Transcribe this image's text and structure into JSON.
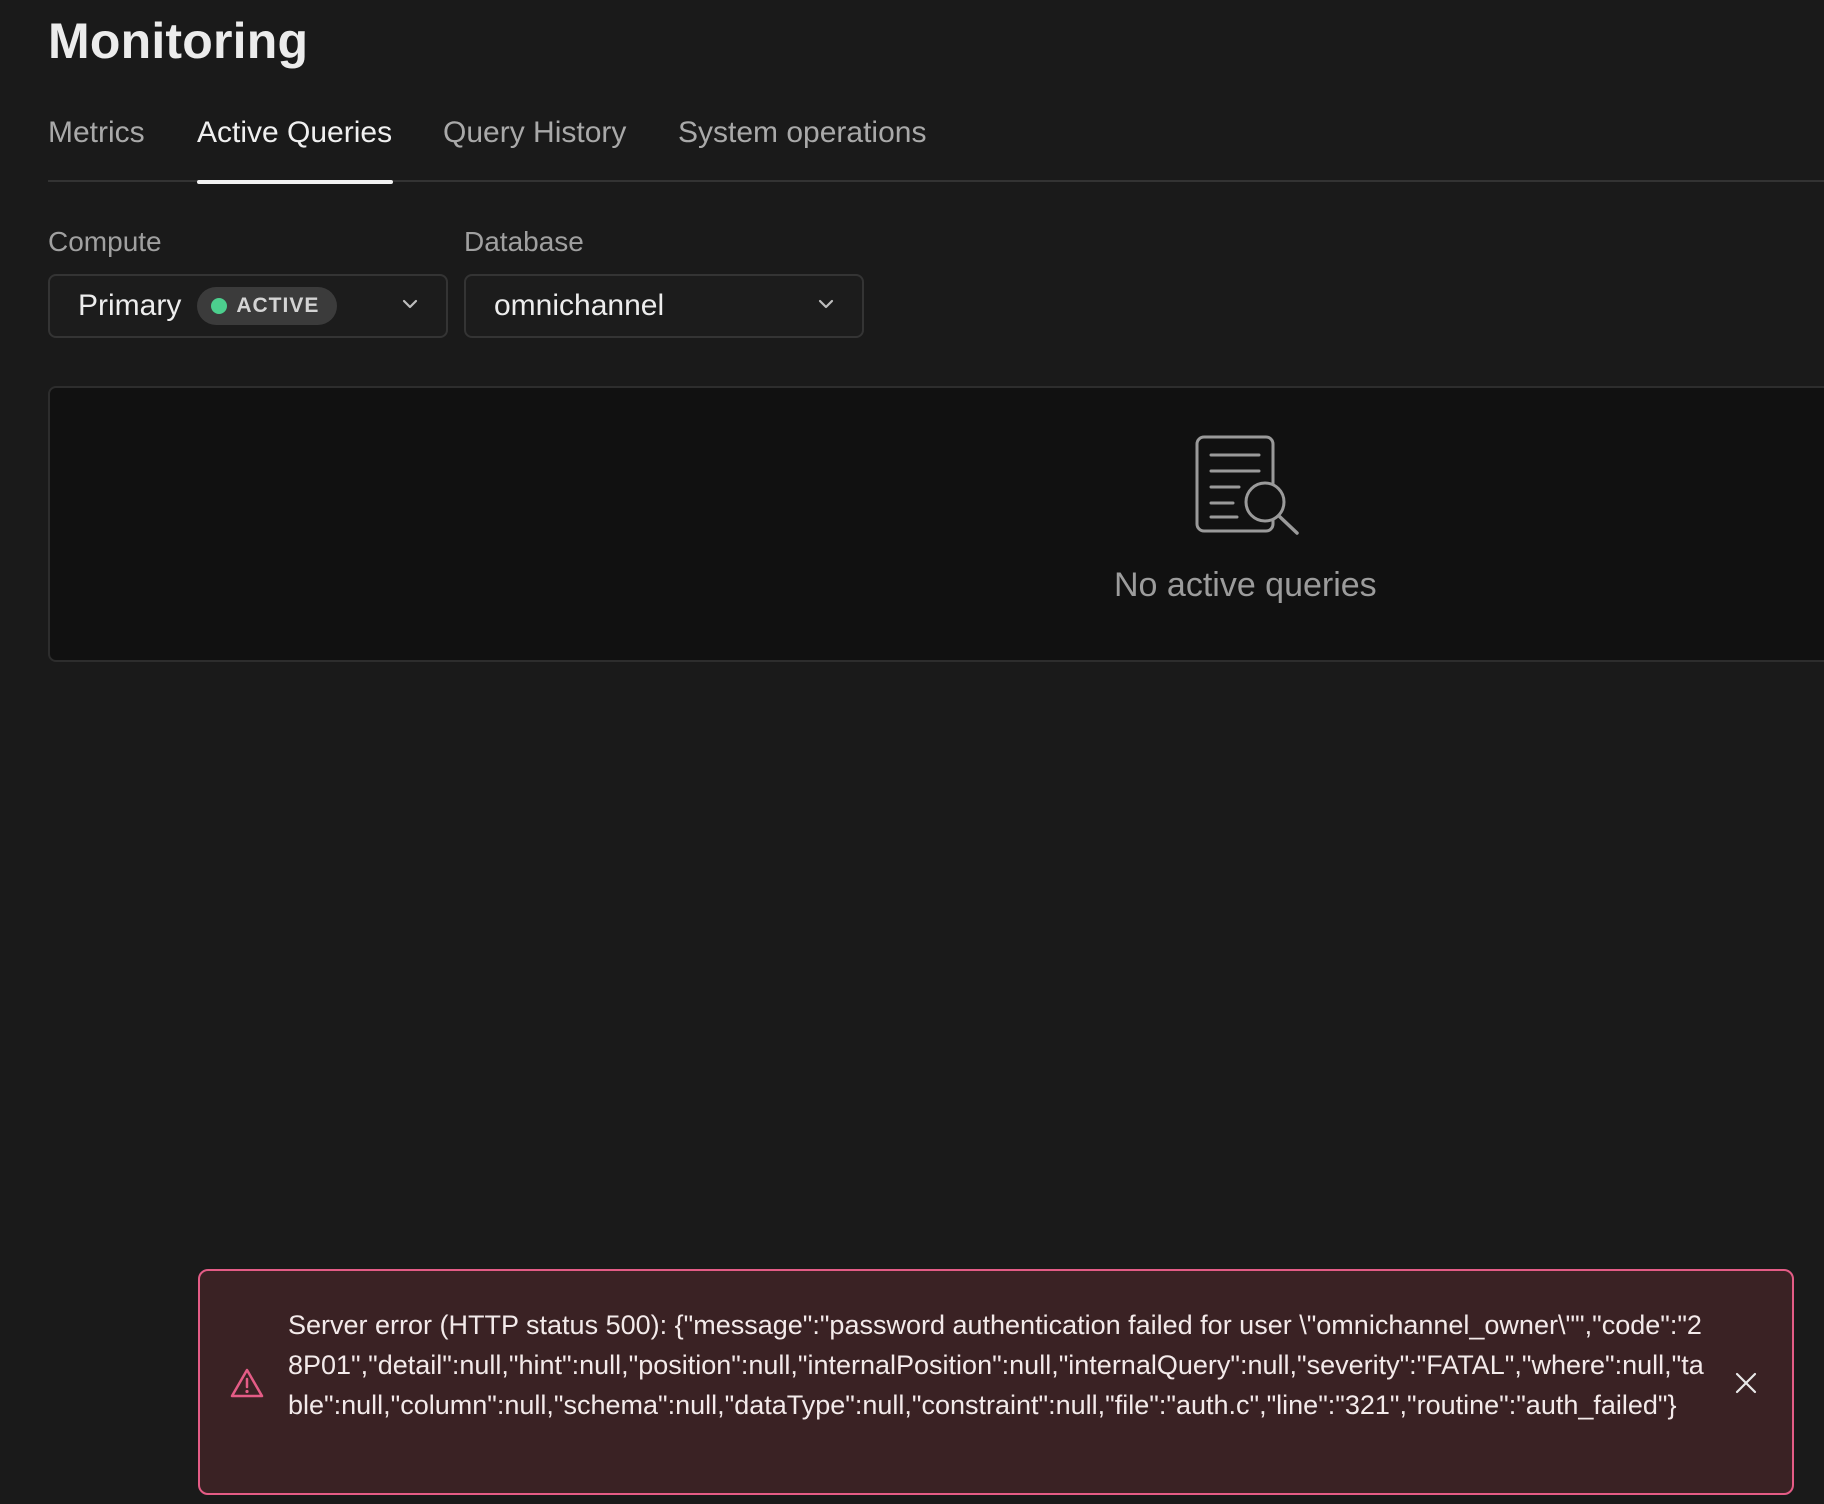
{
  "page": {
    "title": "Monitoring"
  },
  "tabs": [
    {
      "label": "Metrics",
      "active": false
    },
    {
      "label": "Active Queries",
      "active": true
    },
    {
      "label": "Query History",
      "active": false
    },
    {
      "label": "System operations",
      "active": false
    }
  ],
  "filters": {
    "compute": {
      "label": "Compute",
      "value": "Primary",
      "badge": "ACTIVE",
      "badge_color": "#4ccf8e"
    },
    "database": {
      "label": "Database",
      "value": "omnichannel"
    }
  },
  "empty_state": {
    "icon": "document-search-icon",
    "message": "No active queries"
  },
  "error_toast": {
    "icon": "warning-icon",
    "message": "Server error (HTTP status 500): {\"message\":\"password authentication failed for user \\\"omnichannel_owner\\\"\",\"code\":\"28P01\",\"detail\":null,\"hint\":null,\"position\":null,\"internalPosition\":null,\"internalQuery\":null,\"severity\":\"FATAL\",\"where\":null,\"table\":null,\"column\":null,\"schema\":null,\"dataType\":null,\"constraint\":null,\"file\":\"auth.c\",\"line\":\"321\",\"routine\":\"auth_failed\"}",
    "border_color": "#e45c86",
    "close_icon": "close-icon"
  }
}
